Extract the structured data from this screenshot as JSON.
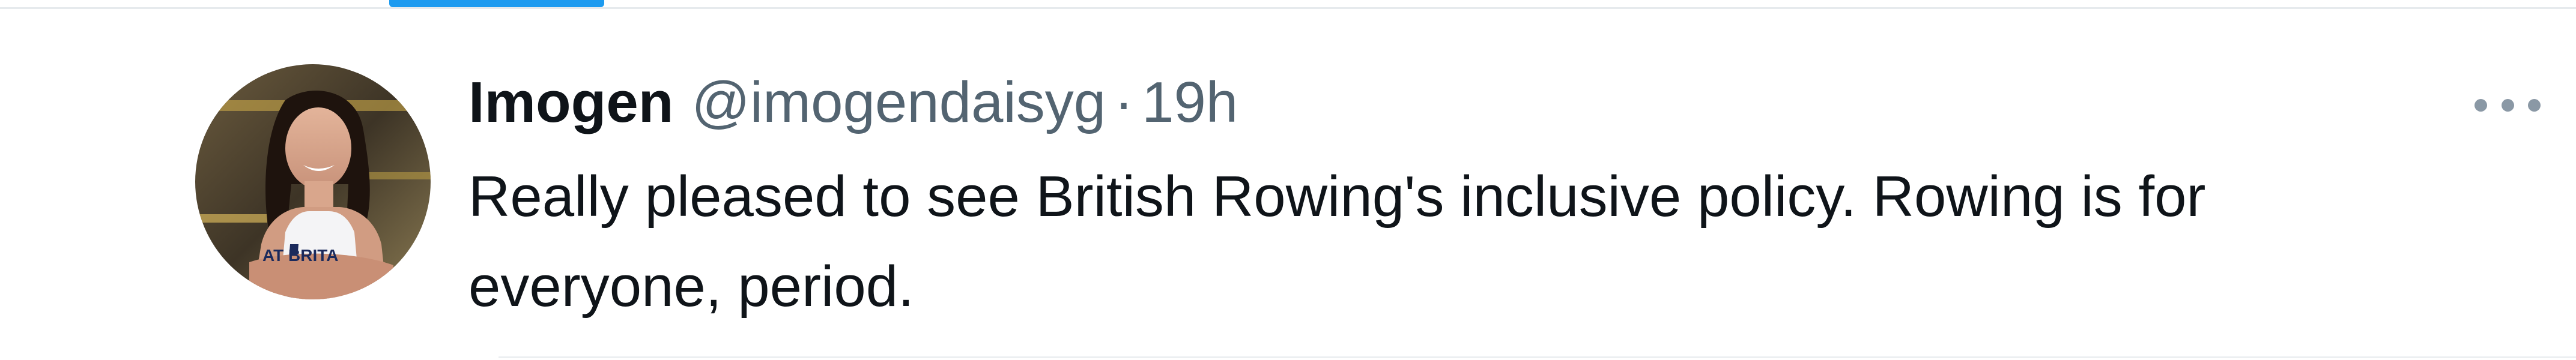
{
  "tweet": {
    "display_name": "Imogen",
    "handle": "@imogendaisyg",
    "separator": "·",
    "timestamp": "19h",
    "text_line_1": "Really pleased to see British Rowing's inclusive policy. Rowing is for",
    "text_line_2": "everyone, period.",
    "avatar_shirt_text": "AT BRITA",
    "more_icon": "more-horizontal-icon"
  },
  "colors": {
    "primary_text": "#0f1419",
    "secondary_text": "#536471",
    "accent": "#1d9bf0",
    "divider": "#e6eaed",
    "icon_gray": "#8a98a5"
  }
}
